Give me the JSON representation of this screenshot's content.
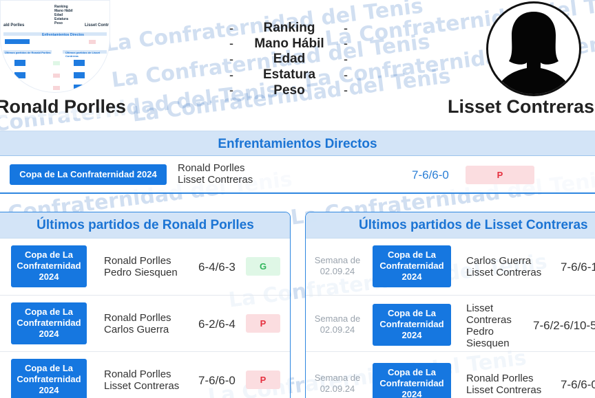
{
  "watermark_text": "La Confraternidad del Tenis",
  "header": {
    "player_left": "Ronald Porlles",
    "player_right": "Lisset Contreras",
    "stats": [
      "Ranking",
      "Mano Hábil",
      "Edad",
      "Estatura",
      "Peso"
    ],
    "left_value_symbol": "-",
    "right_value_symbol": "-",
    "avatar_icon": "female-silhouette-icon"
  },
  "thumbnail": {
    "stats": [
      "Ranking",
      "Mano Hábil",
      "Edad",
      "Estatura",
      "Peso"
    ],
    "player_left": "ald Porlles",
    "player_right": "Lisset Contr",
    "head": "Enfrentamientos Directos",
    "left_title": "Últimos partidos de Ronald Porlles",
    "right_title": "Últimos partidos de Lisset Contreras"
  },
  "direct": {
    "title": "Enfrentamientos Directos",
    "match": {
      "tournament": "Copa de La Confraternidad 2024",
      "player1": "Ronald Porlles",
      "player2": "Lisset Contreras",
      "score": "7-6/6-0",
      "result": "P"
    }
  },
  "left_panel": {
    "title": "Últimos partidos de Ronald Porlles",
    "matches": [
      {
        "tournament": "Copa de La Confraternidad 2024",
        "player1": "Ronald Porlles",
        "player2": "Pedro Siesquen",
        "score": "6-4/6-3",
        "result": "G"
      },
      {
        "tournament": "Copa de La Confraternidad 2024",
        "player1": "Ronald Porlles",
        "player2": "Carlos Guerra",
        "score": "6-2/6-4",
        "result": "P"
      },
      {
        "tournament": "Copa de La Confraternidad 2024",
        "player1": "Ronald Porlles",
        "player2": "Lisset Contreras",
        "score": "7-6/6-0",
        "result": "P"
      }
    ]
  },
  "right_panel": {
    "title": "Últimos partidos de Lisset Contreras",
    "matches": [
      {
        "week": "Semana de 02.09.24",
        "tournament": "Copa de La Confraternidad 2024",
        "player1": "Carlos Guerra",
        "player2": "Lisset Contreras",
        "score": "7-6/6-1"
      },
      {
        "week": "Semana de 02.09.24",
        "tournament": "Copa de La Confraternidad 2024",
        "player1": "Lisset Contreras",
        "player2": "Pedro Siesquen",
        "score": "7-6/2-6/10-5"
      },
      {
        "week": "Semana de 02.09.24",
        "tournament": "Copa de La Confraternidad 2024",
        "player1": "Ronald Porlles",
        "player2": "Lisset Contreras",
        "score": "7-6/6-0"
      }
    ]
  },
  "colors": {
    "accent": "#1677e0",
    "header_bg": "#cfe2f6",
    "loss_bg": "#fbdde0",
    "loss_text": "#e5303f",
    "win_bg": "#dff7e6",
    "win_text": "#2fb55a"
  }
}
